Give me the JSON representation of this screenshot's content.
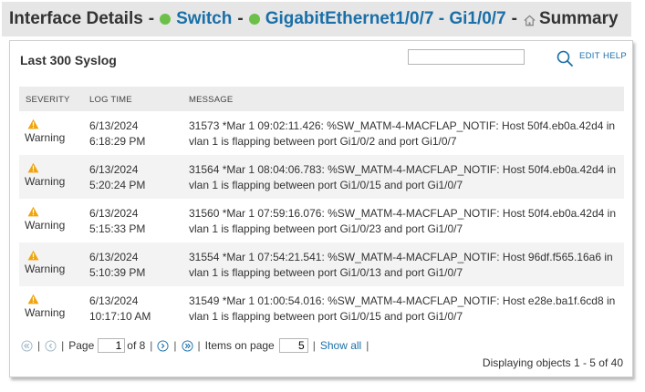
{
  "breadcrumb": {
    "title": "Interface Details",
    "node": "Switch",
    "interface": "GigabitEthernet1/0/7 - Gi1/0/7",
    "view": "Summary",
    "separator": "-",
    "status_color": "#6cc04a"
  },
  "panel": {
    "title": "Last 300 Syslog",
    "search_value": "",
    "edit_label": "EDIT",
    "help_label": "HELP"
  },
  "table": {
    "columns": {
      "severity": "SEVERITY",
      "time": "LOG TIME",
      "message": "MESSAGE"
    },
    "rows": [
      {
        "severity": "Warning",
        "date": "6/13/2024",
        "time": "6:18:29 PM",
        "message": "31573 *Mar 1 09:02:11.426: %SW_MATM-4-MACFLAP_NOTIF: Host 50f4.eb0a.42d4 in vlan 1 is flapping between port Gi1/0/2 and port Gi1/0/7"
      },
      {
        "severity": "Warning",
        "date": "6/13/2024",
        "time": "5:20:24 PM",
        "message": "31564 *Mar 1 08:04:06.783: %SW_MATM-4-MACFLAP_NOTIF: Host 50f4.eb0a.42d4 in vlan 1 is flapping between port Gi1/0/15 and port Gi1/0/7"
      },
      {
        "severity": "Warning",
        "date": "6/13/2024",
        "time": "5:15:33 PM",
        "message": "31560 *Mar 1 07:59:16.076: %SW_MATM-4-MACFLAP_NOTIF: Host 50f4.eb0a.42d4 in vlan 1 is flapping between port Gi1/0/23 and port Gi1/0/7"
      },
      {
        "severity": "Warning",
        "date": "6/13/2024",
        "time": "5:10:39 PM",
        "message": "31554 *Mar 1 07:54:21.541: %SW_MATM-4-MACFLAP_NOTIF: Host 96df.f565.16a6 in vlan 1 is flapping between port Gi1/0/13 and port Gi1/0/7"
      },
      {
        "severity": "Warning",
        "date": "6/13/2024",
        "time": "10:17:10 AM",
        "message": "31549 *Mar 1 01:00:54.016: %SW_MATM-4-MACFLAP_NOTIF: Host e28e.ba1f.6cd8 in vlan 1 is flapping between port Gi1/0/15 and port Gi1/0/7"
      }
    ]
  },
  "pager": {
    "page_label": "Page",
    "page_value": "1",
    "of_label": "of 8",
    "items_label": "Items on page",
    "items_value": "5",
    "show_all_label": "Show all",
    "bar": "|",
    "displaying": "Displaying objects 1 - 5 of 40"
  },
  "colors": {
    "link": "#1a6fa8",
    "warning": "#f0a30a",
    "header_bg": "#e6e6e6"
  }
}
